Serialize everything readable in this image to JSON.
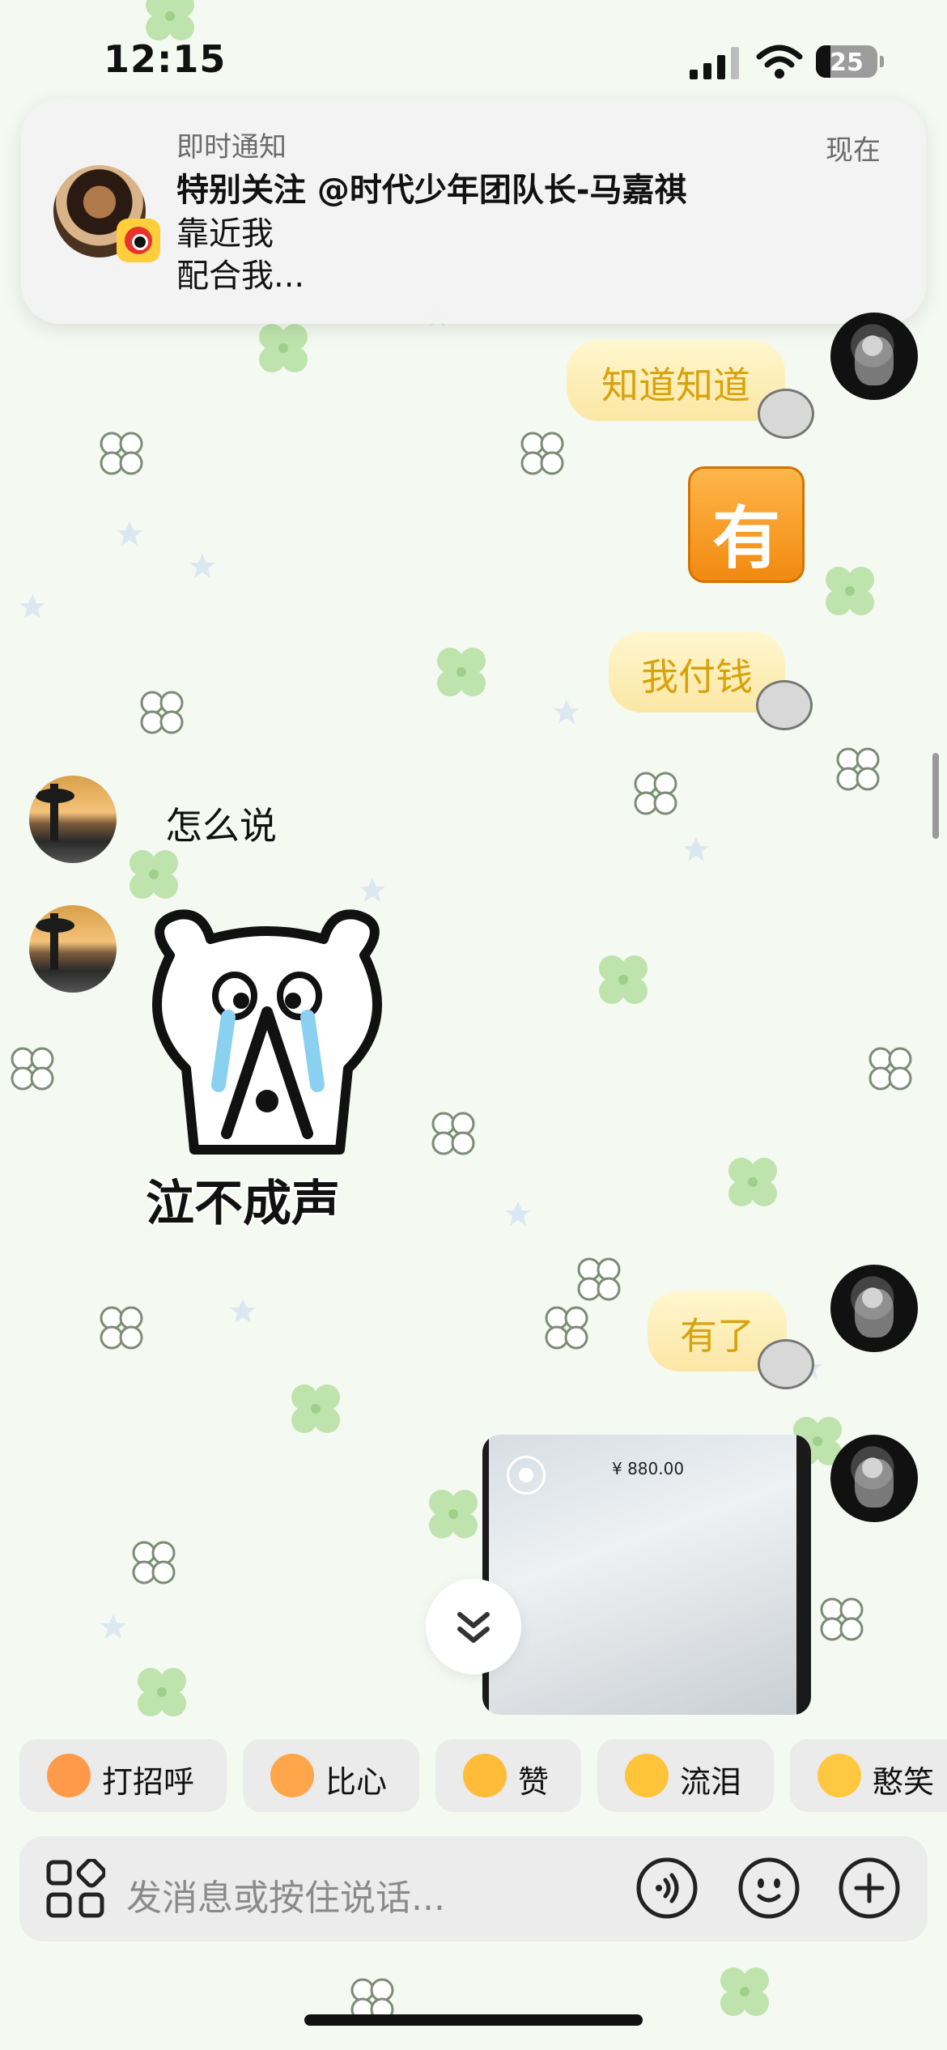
{
  "status_bar": {
    "time": "12:15",
    "battery": "25"
  },
  "notification": {
    "app_label": "即时通知",
    "time_label": "现在",
    "title": "特别关注 @时代少年团队长-马嘉祺",
    "line1": "靠近我",
    "line2": "配合我..."
  },
  "messages": {
    "me_sticker_1": "知道知道",
    "me_emoji_you": "有",
    "me_sticker_2": "我付钱",
    "other_text": "怎么说",
    "other_meme_label": "泣不成声",
    "me_sticker_3": "有了",
    "photo_amount": "¥ 880.00"
  },
  "quick_replies": [
    {
      "label": "打招呼",
      "icon": "wave-emoji-icon",
      "color": "#ff8a3d"
    },
    {
      "label": "比心",
      "icon": "heart-hands-emoji-icon",
      "color": "#ff9b3d"
    },
    {
      "label": "赞",
      "icon": "thumbs-up-emoji-icon",
      "color": "#ffb22a"
    },
    {
      "label": "流泪",
      "icon": "crying-emoji-icon",
      "color": "#ffbf2a"
    },
    {
      "label": "憨笑",
      "icon": "grin-emoji-icon",
      "color": "#ffc12e"
    }
  ],
  "input": {
    "placeholder": "发消息或按住说话..."
  },
  "colors": {
    "background": "#f4f9f2",
    "sticker_text": "#d9a20a",
    "you_emoji_orange": "#f18a10"
  }
}
